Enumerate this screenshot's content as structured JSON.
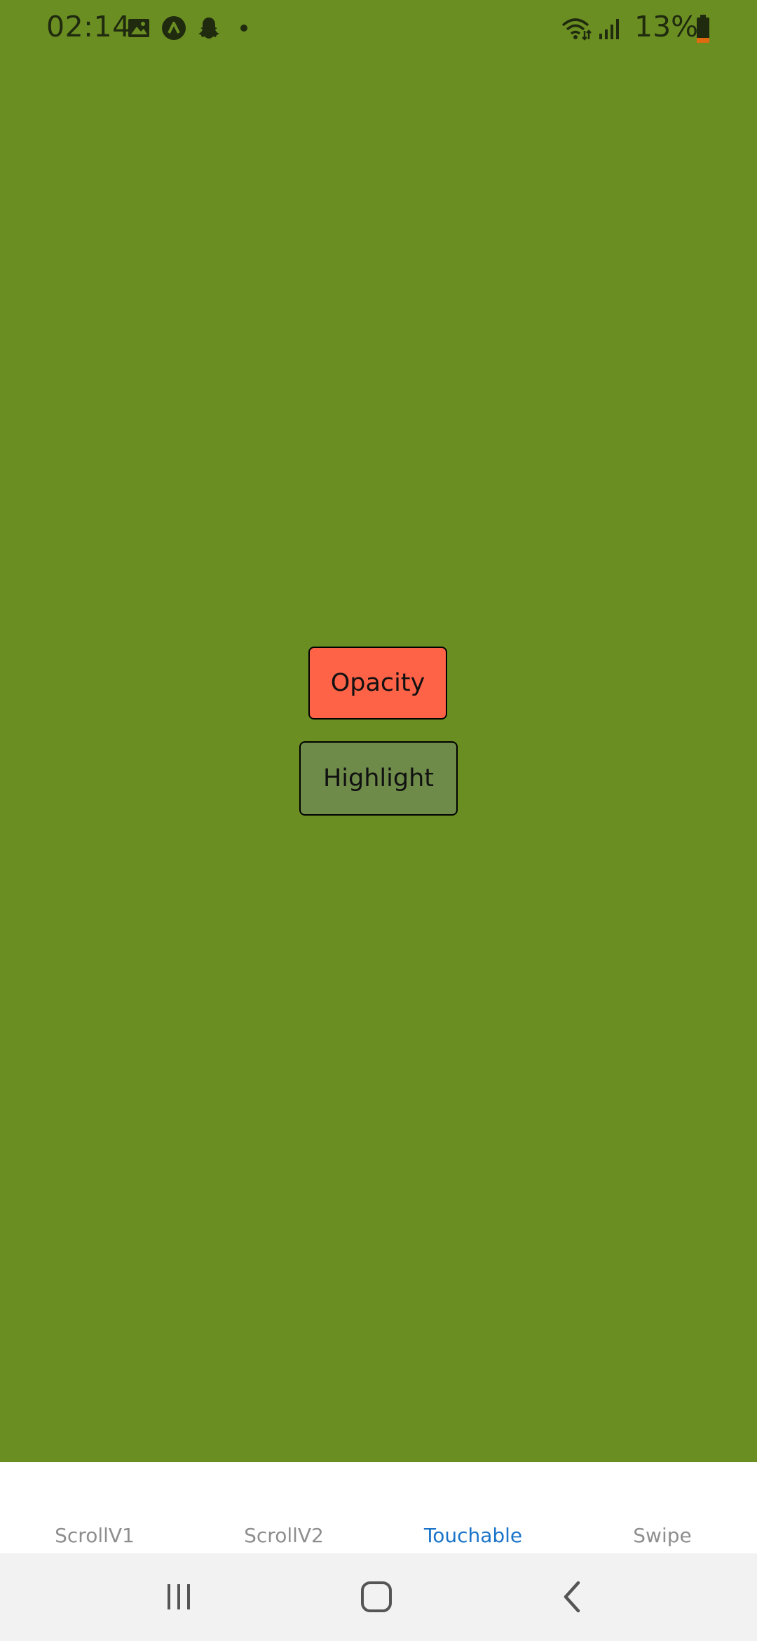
{
  "status_bar": {
    "time": "02:14",
    "battery": "13%",
    "notification_icons": [
      "image-icon",
      "app-icon",
      "snapchat-icon",
      "dot-icon"
    ],
    "system_icons": [
      "wifi-icon",
      "signal-icon",
      "battery-icon"
    ]
  },
  "main": {
    "opacity_label": "Opacity",
    "highlight_label": "Highlight",
    "background_color": "#6B8E23",
    "opacity_color": "#FF6347",
    "highlight_color": "#6E8B4A"
  },
  "tabs": [
    {
      "label": "ScrollV1",
      "active": false
    },
    {
      "label": "ScrollV2",
      "active": false
    },
    {
      "label": "Touchable",
      "active": true
    },
    {
      "label": "Swipe",
      "active": false
    }
  ],
  "accent_color": "#1a73c8",
  "nav": {
    "icons": [
      "recent-apps-icon",
      "home-icon",
      "back-icon"
    ]
  }
}
